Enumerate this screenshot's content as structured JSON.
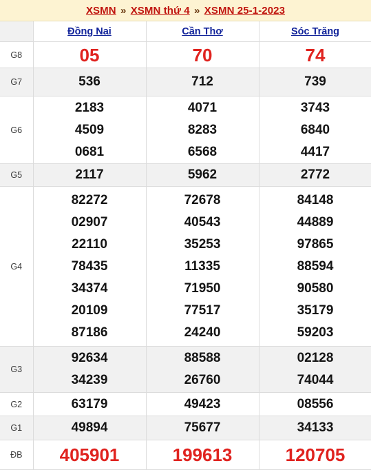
{
  "breadcrumb": {
    "separator": "»",
    "items": [
      {
        "label": "XSMN"
      },
      {
        "label": "XSMN thứ 4"
      },
      {
        "label": "XSMN 25-1-2023"
      }
    ]
  },
  "table": {
    "corner_label": "",
    "provinces": [
      "Đồng Nai",
      "Cần Thơ",
      "Sóc Trăng"
    ],
    "rows": [
      {
        "prize": "G8",
        "shade": "plain",
        "results": [
          [
            "05"
          ],
          [
            "70"
          ],
          [
            "74"
          ]
        ]
      },
      {
        "prize": "G7",
        "shade": "alt",
        "results": [
          [
            "536"
          ],
          [
            "712"
          ],
          [
            "739"
          ]
        ]
      },
      {
        "prize": "G6",
        "shade": "plain",
        "results": [
          [
            "2183",
            "4509",
            "0681"
          ],
          [
            "4071",
            "8283",
            "6568"
          ],
          [
            "3743",
            "6840",
            "4417"
          ]
        ]
      },
      {
        "prize": "G5",
        "shade": "alt",
        "results": [
          [
            "2117"
          ],
          [
            "5962"
          ],
          [
            "2772"
          ]
        ]
      },
      {
        "prize": "G4",
        "shade": "plain",
        "results": [
          [
            "82272",
            "02907",
            "22110",
            "78435",
            "34374",
            "20109",
            "87186"
          ],
          [
            "72678",
            "40543",
            "35253",
            "11335",
            "71950",
            "77517",
            "24240"
          ],
          [
            "84148",
            "44889",
            "97865",
            "88594",
            "90580",
            "35179",
            "59203"
          ]
        ]
      },
      {
        "prize": "G3",
        "shade": "alt",
        "results": [
          [
            "92634",
            "34239"
          ],
          [
            "88588",
            "26760"
          ],
          [
            "02128",
            "74044"
          ]
        ]
      },
      {
        "prize": "G2",
        "shade": "plain",
        "results": [
          [
            "63179"
          ],
          [
            "49423"
          ],
          [
            "08556"
          ]
        ]
      },
      {
        "prize": "G1",
        "shade": "alt",
        "results": [
          [
            "49894"
          ],
          [
            "75677"
          ],
          [
            "34133"
          ]
        ]
      },
      {
        "prize": "ĐB",
        "shade": "plain",
        "results": [
          [
            "405901"
          ],
          [
            "199613"
          ],
          [
            "120705"
          ]
        ]
      }
    ]
  },
  "colors": {
    "breadcrumb_bg": "#fdf3d2",
    "breadcrumb_link": "#c0150f",
    "province_link": "#12249a",
    "highlight_number": "#e0231f",
    "normal_number": "#141414",
    "alt_row_bg": "#f1f1f1"
  }
}
